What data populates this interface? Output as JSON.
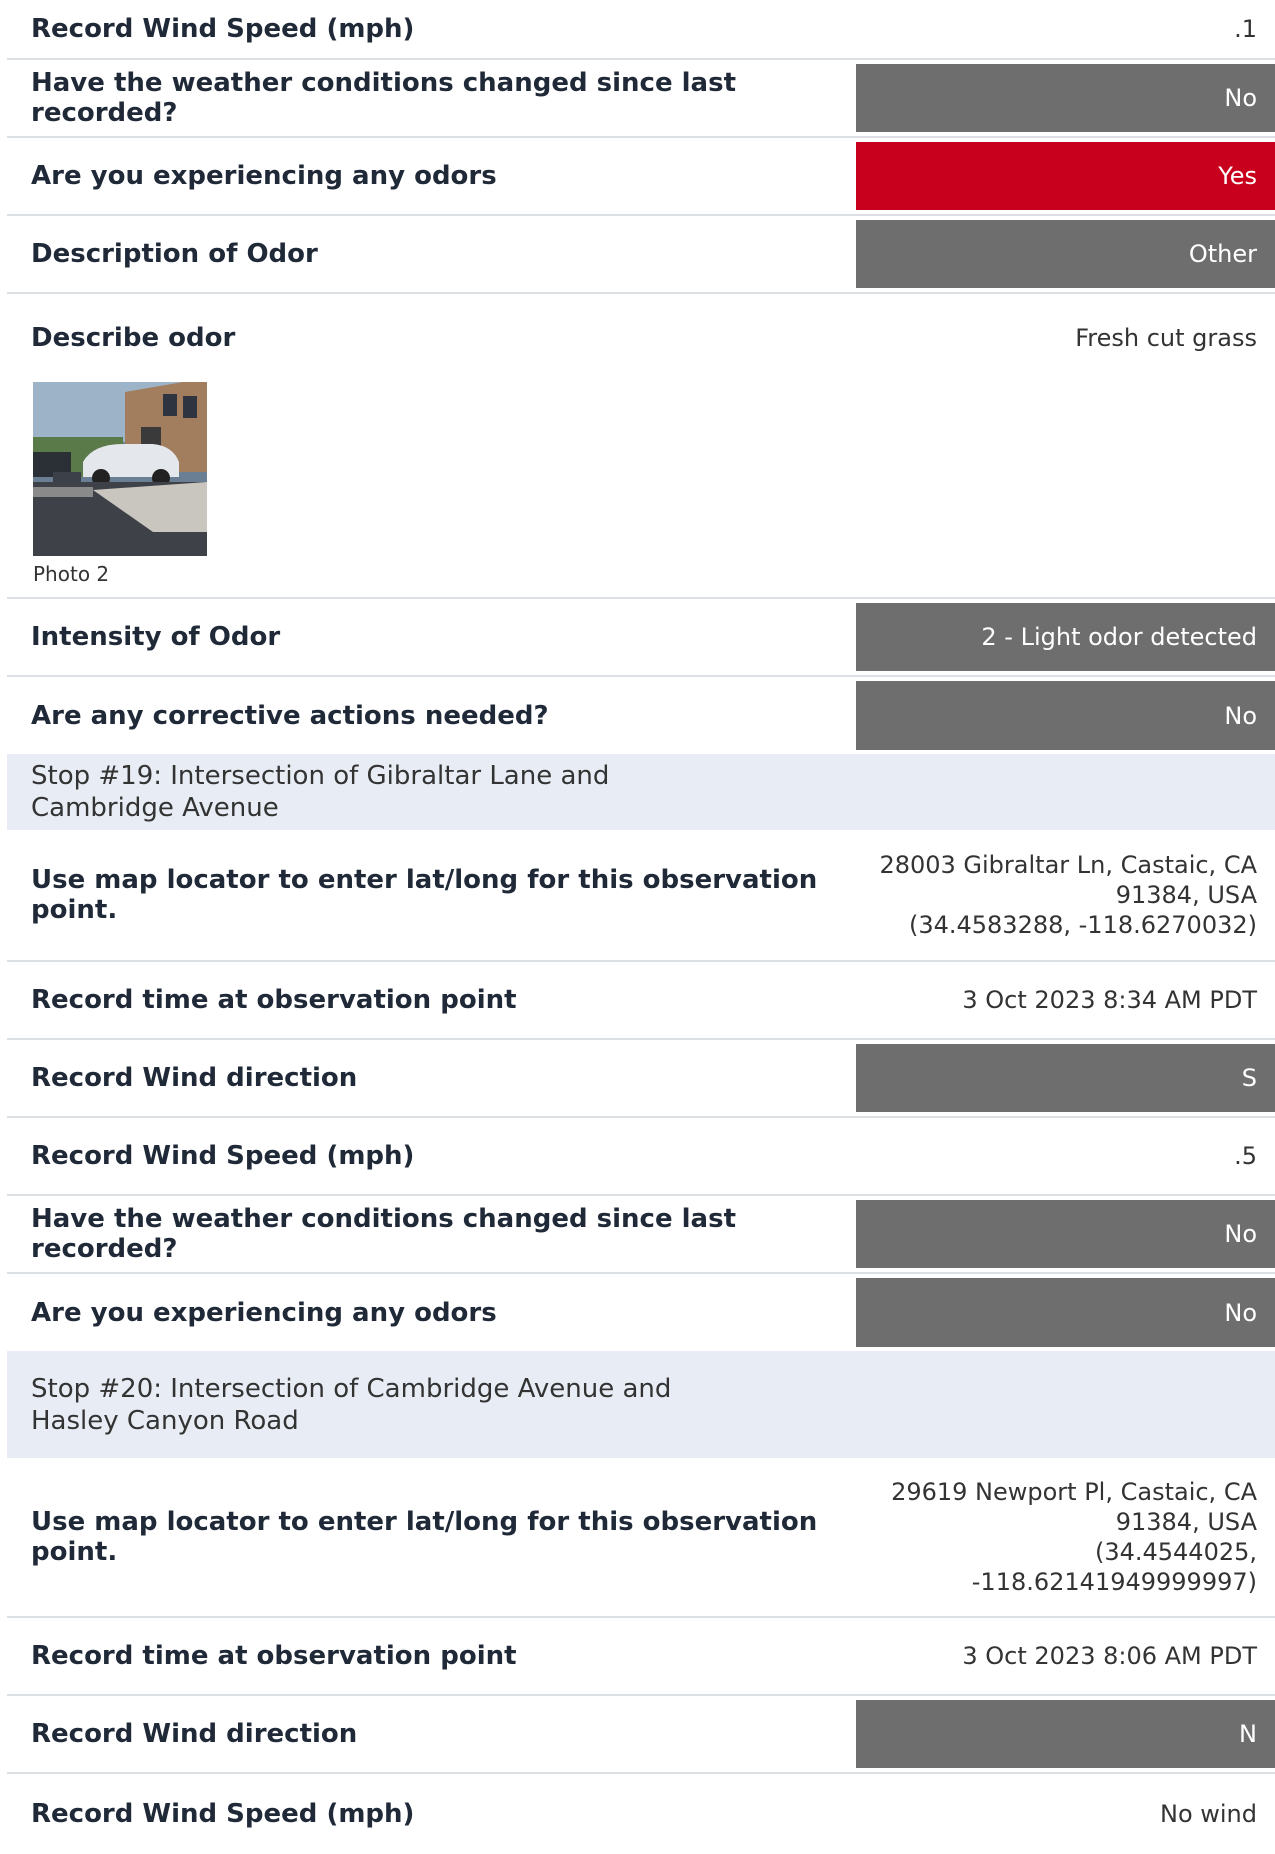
{
  "rows": {
    "r1": {
      "label": "Record Wind Speed (mph)",
      "value": ".1"
    },
    "r2": {
      "label": "Have the weather conditions changed since last recorded?",
      "value": "No"
    },
    "r3": {
      "label": "Are you experiencing any odors",
      "value": "Yes"
    },
    "r4": {
      "label": "Description of Odor",
      "value": "Other"
    },
    "r5": {
      "label": "Describe odor",
      "value": "Fresh cut grass"
    },
    "r6": {
      "label": "Intensity of Odor",
      "value": "2 - Light odor detected"
    },
    "r7": {
      "label": "Are any corrective actions needed?",
      "value": "No"
    },
    "r8": {
      "label": "Use map locator to enter lat/long for this observation point.",
      "value_lines": [
        "28003 Gibraltar Ln, Castaic, CA",
        "91384, USA",
        "(34.4583288, -118.6270032)"
      ]
    },
    "r9": {
      "label": "Record time at observation point",
      "value": "3 Oct 2023 8:34 AM PDT"
    },
    "r10": {
      "label": "Record Wind direction",
      "value": "S"
    },
    "r11": {
      "label": "Record Wind Speed (mph)",
      "value": ".5"
    },
    "r12": {
      "label": "Have the weather conditions changed since last recorded?",
      "value": "No"
    },
    "r13": {
      "label": "Are you experiencing any odors",
      "value": "No"
    },
    "r14": {
      "label": "Use map locator to enter lat/long for this observation point.",
      "value_lines": [
        "29619 Newport Pl, Castaic, CA",
        "91384, USA",
        "(34.4544025,",
        "-118.62141949999997)"
      ]
    },
    "r15": {
      "label": "Record time at observation point",
      "value": "3 Oct 2023 8:06 AM PDT"
    },
    "r16": {
      "label": "Record Wind direction",
      "value": "N"
    },
    "r17": {
      "label": "Record Wind Speed (mph)",
      "value": "No wind"
    }
  },
  "sections": {
    "s19": "Stop #19: Intersection of Gibraltar Lane and Cambridge Avenue",
    "s20": "Stop #20: Intersection of Cambridge Avenue and Hasley Canyon Road"
  },
  "photo": {
    "caption": "Photo 2"
  },
  "colors": {
    "dropdown_gray": "#6e6e6e",
    "alert_red": "#c8001e",
    "section_bg": "#e8edf5"
  }
}
